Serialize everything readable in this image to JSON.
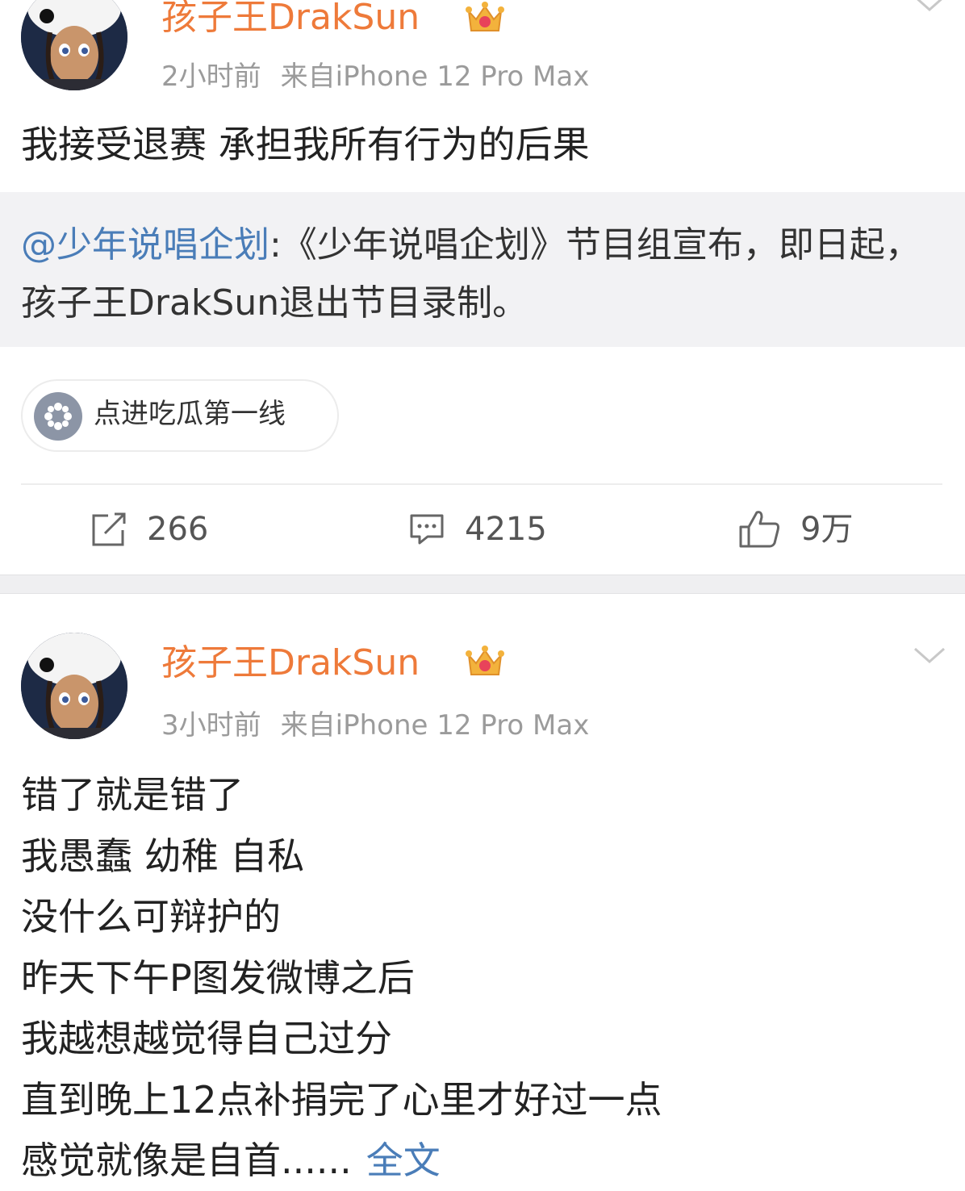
{
  "post1": {
    "username": "孩子王DrakSun",
    "time": "2小时前",
    "source": "来自iPhone 12 Pro Max",
    "text": "我接受退赛 承担我所有行为的后果",
    "repost": {
      "mention": "@少年说唱企划",
      "text": ":《少年说唱企划》节目组宣布，即日起，孩子王DrakSun退出节目录制。"
    },
    "topic_label": "点进吃瓜第一线",
    "actions": {
      "repost_count": "266",
      "comment_count": "4215",
      "like_count": "9万"
    }
  },
  "post2": {
    "username": "孩子王DrakSun",
    "time": "3小时前",
    "source": "来自iPhone 12 Pro Max",
    "lines": [
      "错了就是错了",
      "我愚蠢 幼稚 自私",
      "没什么可辩护的",
      "昨天下午P图发微博之后",
      "我越想越觉得自己过分",
      "直到晚上12点补捐完了心里才好过一点",
      "感觉就像是自首......"
    ],
    "full_text_link": "全文"
  },
  "colors": {
    "username": "#ee7a3a",
    "link": "#4a7db8",
    "meta": "#9b9b9b",
    "repost_bg": "#f2f2f4"
  },
  "icons": [
    "crown-badge-icon",
    "chevron-down-icon",
    "topic-icon",
    "repost-icon",
    "comment-icon",
    "like-icon"
  ]
}
